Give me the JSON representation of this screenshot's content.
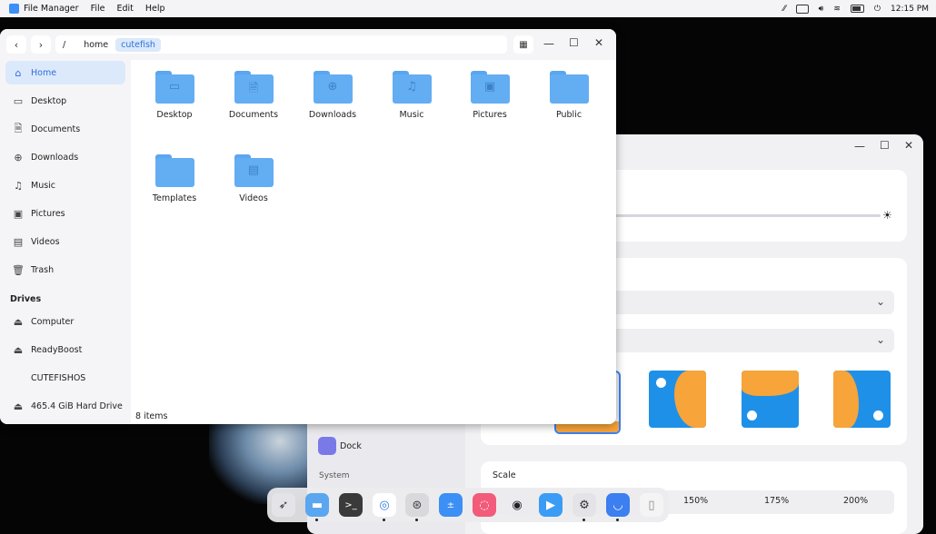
{
  "topbar": {
    "app_name": "File Manager",
    "menus": [
      "File",
      "Edit",
      "Help"
    ],
    "clock": "12:15 PM"
  },
  "file_manager": {
    "breadcrumbs": [
      "/",
      "home",
      "cutefish"
    ],
    "sidebar": {
      "places": [
        {
          "label": "Home",
          "icon": "home-icon",
          "active": true
        },
        {
          "label": "Desktop",
          "icon": "desktop-icon"
        },
        {
          "label": "Documents",
          "icon": "documents-icon"
        },
        {
          "label": "Downloads",
          "icon": "downloads-icon"
        },
        {
          "label": "Music",
          "icon": "music-icon"
        },
        {
          "label": "Pictures",
          "icon": "pictures-icon"
        },
        {
          "label": "Videos",
          "icon": "videos-icon"
        },
        {
          "label": "Trash",
          "icon": "trash-icon"
        }
      ],
      "drives_header": "Drives",
      "drives": [
        {
          "label": "Computer",
          "icon": "drive-icon"
        },
        {
          "label": "ReadyBoost",
          "icon": "drive-icon"
        },
        {
          "label": "CUTEFISHOS",
          "icon": ""
        },
        {
          "label": "465.4 GiB Hard Drive",
          "icon": "drive-icon"
        }
      ]
    },
    "folders": [
      {
        "label": "Desktop",
        "icon": "desktop-folder-icon"
      },
      {
        "label": "Documents",
        "icon": "documents-folder-icon"
      },
      {
        "label": "Downloads",
        "icon": "downloads-folder-icon"
      },
      {
        "label": "Music",
        "icon": "music-folder-icon"
      },
      {
        "label": "Pictures",
        "icon": "pictures-folder-icon"
      },
      {
        "label": "Public",
        "icon": "folder-icon"
      },
      {
        "label": "Templates",
        "icon": "folder-icon"
      },
      {
        "label": "Videos",
        "icon": "videos-folder-icon"
      }
    ],
    "status": "8 items"
  },
  "settings": {
    "brightness_level": 0.1,
    "sidebar_items": [
      "Dock",
      "System"
    ],
    "scale_label": "Scale",
    "scale_options": [
      "150%",
      "175%",
      "200%"
    ]
  },
  "colors": {
    "accent": "#3b82f6",
    "folder": "#63adf3",
    "wallpaper_orange": "#f7a43a",
    "wallpaper_blue": "#1e90e8"
  }
}
